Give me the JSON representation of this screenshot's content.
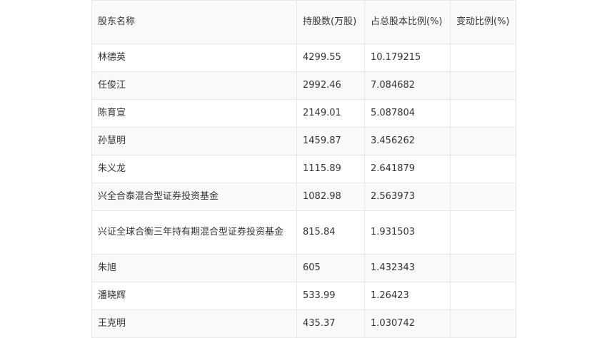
{
  "table": {
    "headers": [
      "股东名称",
      "持股数(万股)",
      "占总股本比例(%)",
      "变动比例(%)"
    ],
    "rows": [
      [
        "林德英",
        "4299.55",
        "10.179215",
        ""
      ],
      [
        "任俊江",
        "2992.46",
        "7.084682",
        ""
      ],
      [
        "陈育宣",
        "2149.01",
        "5.087804",
        ""
      ],
      [
        "孙慧明",
        "1459.87",
        "3.456262",
        ""
      ],
      [
        "朱义龙",
        "1115.89",
        "2.641879",
        ""
      ],
      [
        "兴全合泰混合型证券投资基金",
        "1082.98",
        "2.563973",
        ""
      ],
      [
        "兴证全球合衡三年持有期混合型证券投资基金",
        "815.84",
        "1.931503",
        ""
      ],
      [
        "朱旭",
        "605",
        "1.432343",
        ""
      ],
      [
        "潘晓辉",
        "533.99",
        "1.26423",
        ""
      ],
      [
        "王克明",
        "435.37",
        "1.030742",
        ""
      ]
    ]
  }
}
